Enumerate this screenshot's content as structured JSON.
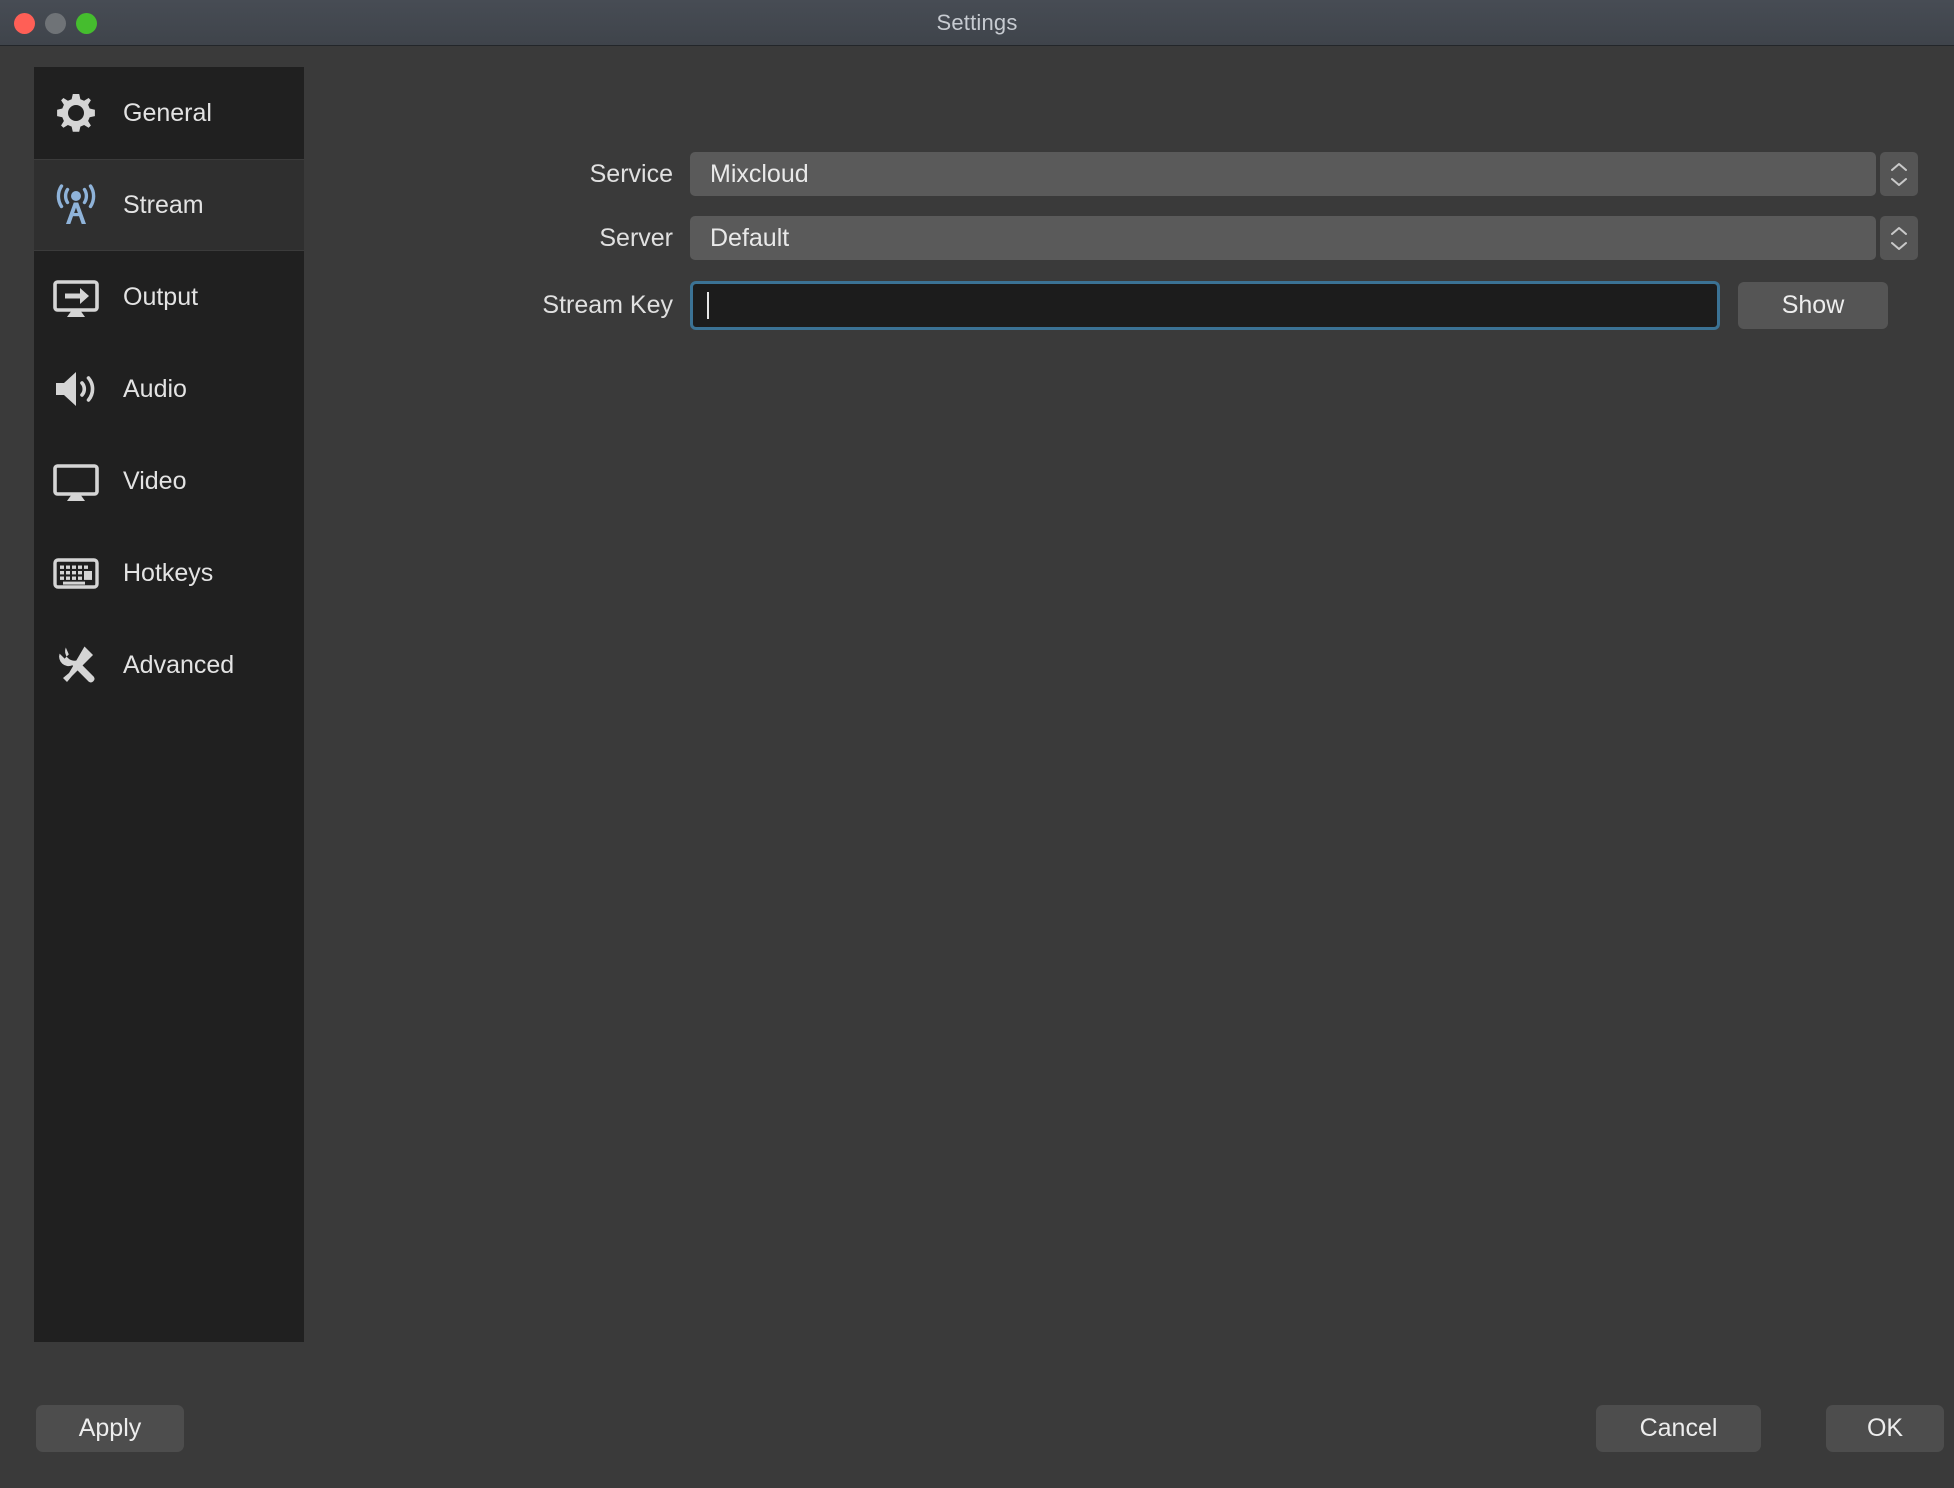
{
  "window": {
    "title": "Settings",
    "traffic_lights": [
      {
        "name": "close",
        "color": "#ff5f56"
      },
      {
        "name": "minimize",
        "color": "#6f7377"
      },
      {
        "name": "zoom",
        "color": "#45bd2e"
      }
    ]
  },
  "sidebar": {
    "items": [
      {
        "label": "General",
        "icon": "gear-icon",
        "selected": false
      },
      {
        "label": "Stream",
        "icon": "broadcast-icon",
        "selected": true
      },
      {
        "label": "Output",
        "icon": "monitor-arrow-icon",
        "selected": false
      },
      {
        "label": "Audio",
        "icon": "speaker-icon",
        "selected": false
      },
      {
        "label": "Video",
        "icon": "display-icon",
        "selected": false
      },
      {
        "label": "Hotkeys",
        "icon": "keyboard-icon",
        "selected": false
      },
      {
        "label": "Advanced",
        "icon": "tools-icon",
        "selected": false
      }
    ]
  },
  "main": {
    "service": {
      "label": "Service",
      "value": "Mixcloud",
      "options": [
        "Mixcloud"
      ]
    },
    "server": {
      "label": "Server",
      "value": "Default",
      "options": [
        "Default"
      ]
    },
    "stream_key": {
      "label": "Stream Key",
      "value": "",
      "placeholder": "",
      "focused": true,
      "show_button_label": "Show"
    }
  },
  "footer": {
    "apply_label": "Apply",
    "cancel_label": "Cancel",
    "ok_label": "OK"
  },
  "colors": {
    "window_bg": "#3a3a3a",
    "sidebar_bg": "#202020",
    "sidebar_selected_bg": "#2f2f2f",
    "titlebar_bg": "#434850",
    "field_bg": "#5a5a5a",
    "input_bg": "#1c1c1c",
    "focus_ring": "#3b7294",
    "stream_icon": "#8fb3d9",
    "text": "#e3e3e3"
  }
}
